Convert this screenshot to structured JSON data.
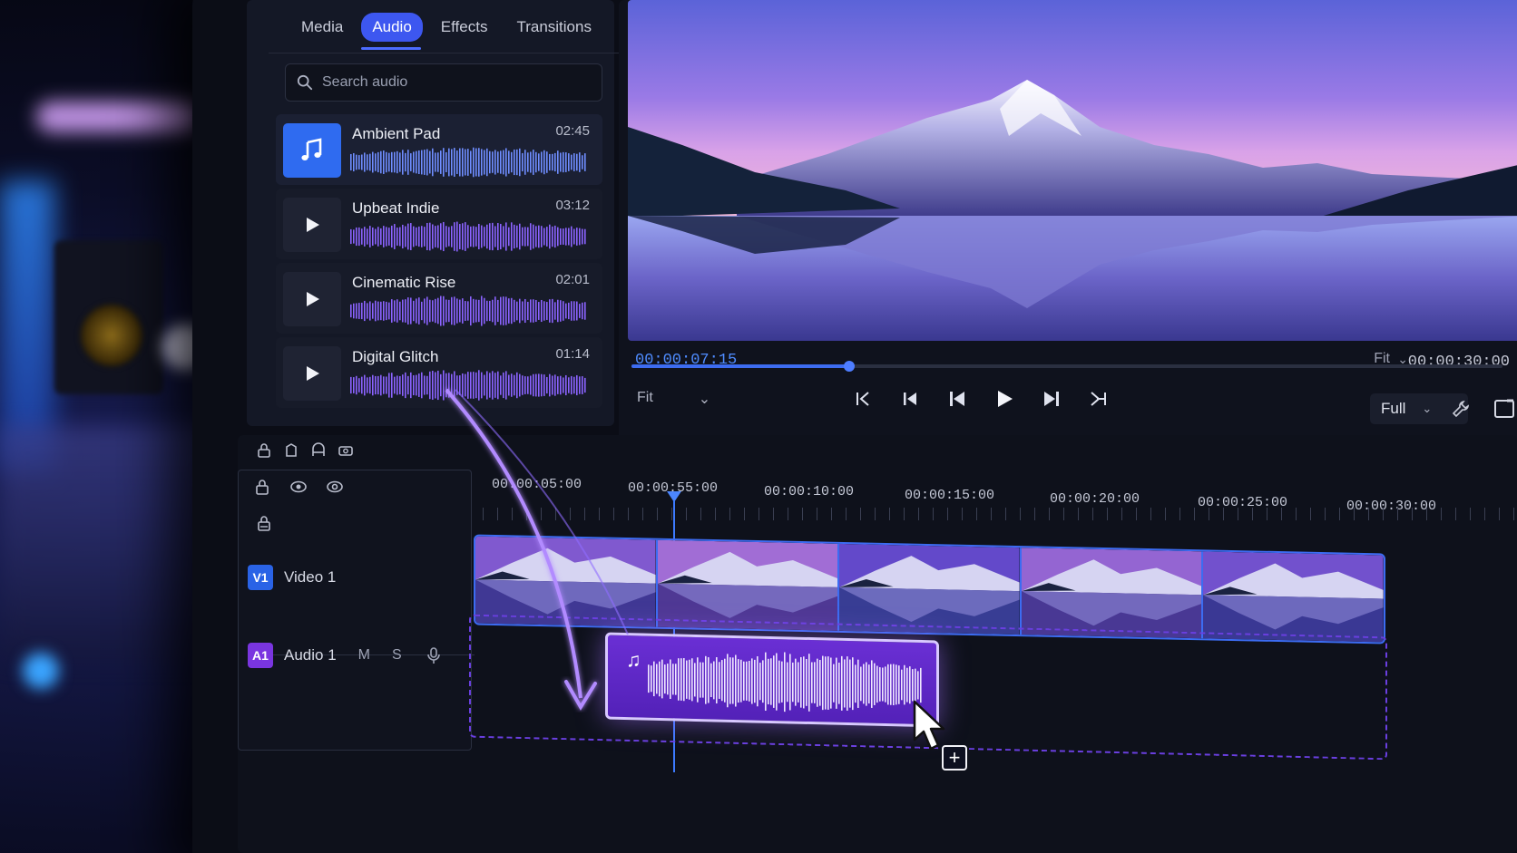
{
  "tabs": [
    {
      "label": "Media",
      "active": false
    },
    {
      "label": "Audio",
      "active": true
    },
    {
      "label": "Effects",
      "active": false
    },
    {
      "label": "Transitions",
      "active": false
    }
  ],
  "search": {
    "placeholder": "Search audio"
  },
  "audio_items": [
    {
      "name": "Ambient Pad",
      "duration": "02:45",
      "selected": true,
      "icon": "music-note-icon"
    },
    {
      "name": "Upbeat Indie",
      "duration": "03:12",
      "selected": false,
      "icon": "play-icon"
    },
    {
      "name": "Cinematic Rise",
      "duration": "02:01",
      "selected": false,
      "icon": "play-icon"
    },
    {
      "name": "Digital Glitch",
      "duration": "01:14",
      "selected": false,
      "icon": "play-icon"
    }
  ],
  "preview": {
    "current_timecode": "00:00:07:15",
    "total_timecode": "00:00:30:00",
    "progress": 0.25,
    "fit_left": "Fit",
    "fit_right": "Fit",
    "quality": "Full"
  },
  "transport": [
    "go-to-in-icon",
    "step-back-icon",
    "previous-frame-icon",
    "play-icon",
    "next-frame-icon",
    "go-to-out-icon"
  ],
  "timeline": {
    "ruler_labels": [
      "00:00:05:00",
      "00:00:55:00",
      "00:00:10:00",
      "00:00:15:00",
      "00:00:20:00",
      "00:00:25:00",
      "00:00:30:00"
    ],
    "tracks": {
      "video": {
        "badge": "V1",
        "name": "Video 1"
      },
      "audio": {
        "badge": "A1",
        "name": "Audio 1",
        "mute": "M",
        "solo": "S"
      }
    }
  },
  "colors": {
    "accent": "#3d57f0",
    "audio_clip": "#6a2fd4",
    "video_border": "#3c6cf2",
    "playhead": "#3d7bff"
  }
}
